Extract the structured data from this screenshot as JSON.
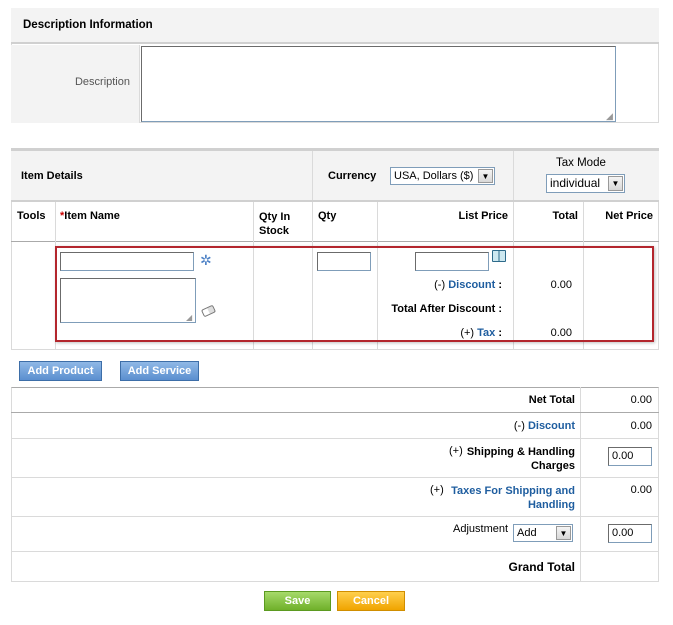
{
  "description_section": {
    "title": "Description Information",
    "description_label": "Description",
    "description_value": ""
  },
  "item_details": {
    "title": "Item Details",
    "currency_label": "Currency",
    "currency_value": "USA, Dollars ($)",
    "tax_mode_label": "Tax Mode",
    "tax_mode_value": "individual",
    "columns": {
      "tools": "Tools",
      "item_name_required": "*",
      "item_name": "Item Name",
      "qty_in_stock": "Qty In Stock",
      "qty": "Qty",
      "list_price": "List Price",
      "total": "Total",
      "net_price": "Net Price"
    },
    "row": {
      "discount_prefix": "(-)",
      "discount_label": "Discount",
      "discount_value": "0.00",
      "total_after_discount_label": "Total After Discount :",
      "tax_prefix": "(+)",
      "tax_label": "Tax",
      "tax_value": "0.00"
    }
  },
  "buttons": {
    "add_product": "Add Product",
    "add_service": "Add Service",
    "save": "Save",
    "cancel": "Cancel"
  },
  "totals": {
    "net_total_label": "Net Total",
    "net_total_value": "0.00",
    "discount_prefix": "(-)",
    "discount_label": "Discount",
    "discount_value": "0.00",
    "shipping_prefix": "(+)",
    "shipping_label": "Shipping & Handling Charges",
    "shipping_value": "0.00",
    "taxes_shipping_prefix": "(+)",
    "taxes_shipping_label": "Taxes For Shipping and Handling",
    "taxes_shipping_value": "0.00",
    "adjustment_label": "Adjustment",
    "adjustment_type": "Add",
    "adjustment_value": "0.00",
    "grand_total_label": "Grand Total",
    "grand_total_value": ""
  },
  "colors": {
    "link": "#1e5d9f",
    "highlight_border": "#b3262d",
    "header_bg": "#f3f3f3"
  },
  "icons": {
    "product_search": "gear-icon",
    "clear_comment": "eraser-icon",
    "price_book": "book-icon"
  }
}
